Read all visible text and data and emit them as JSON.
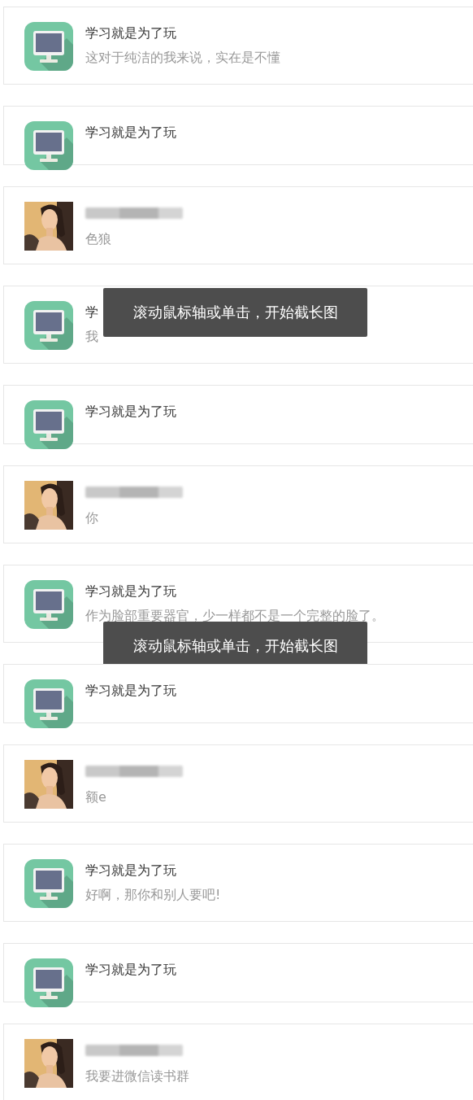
{
  "cards": [
    {
      "kind": "app",
      "title": "学习就是为了玩",
      "message": "这对于纯洁的我来说，实在是不懂"
    },
    {
      "kind": "app",
      "title": "学习就是为了玩"
    },
    {
      "message": "色狼"
    },
    {
      "kind": "app",
      "title": "学",
      "message": "我",
      "tooltip": "滚动鼠标轴或单击，开始截长图"
    },
    {
      "kind": "app",
      "title": "学习就是为了玩"
    },
    {
      "message": "你"
    },
    {
      "kind": "app",
      "title": "学习就是为了玩",
      "message": "作为脸部重要器官，少一样都不是一个完整的脸了。",
      "tooltip": "滚动鼠标轴或单击，开始截长图"
    },
    {
      "kind": "app",
      "title": "学习就是为了玩"
    },
    {
      "message": "额e"
    },
    {
      "kind": "app",
      "title": "学习就是为了玩",
      "message": "好啊，那你和别人要吧!"
    },
    {
      "kind": "app",
      "title": "学习就是为了玩"
    },
    {
      "message": "我要进微信读书群"
    }
  ]
}
